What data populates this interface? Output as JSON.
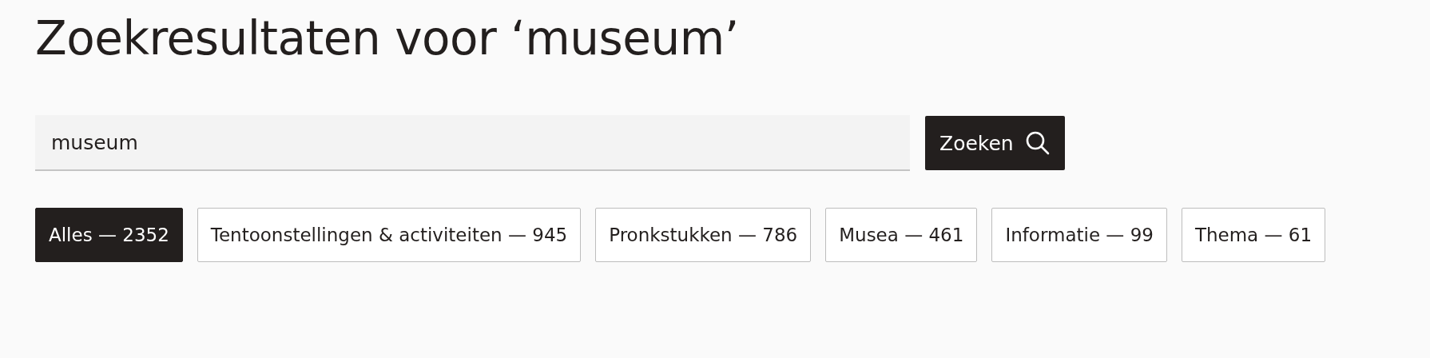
{
  "title": "Zoekresultaten voor ‘museum’",
  "search": {
    "value": "museum",
    "button": "Zoeken"
  },
  "filters": [
    {
      "label": "Alles — 2352",
      "selected": true
    },
    {
      "label": "Tentoonstellingen & activiteiten — 945",
      "selected": false
    },
    {
      "label": "Pronkstukken — 786",
      "selected": false
    },
    {
      "label": "Musea — 461",
      "selected": false
    },
    {
      "label": "Informatie — 99",
      "selected": false
    },
    {
      "label": "Thema — 61",
      "selected": false
    }
  ]
}
